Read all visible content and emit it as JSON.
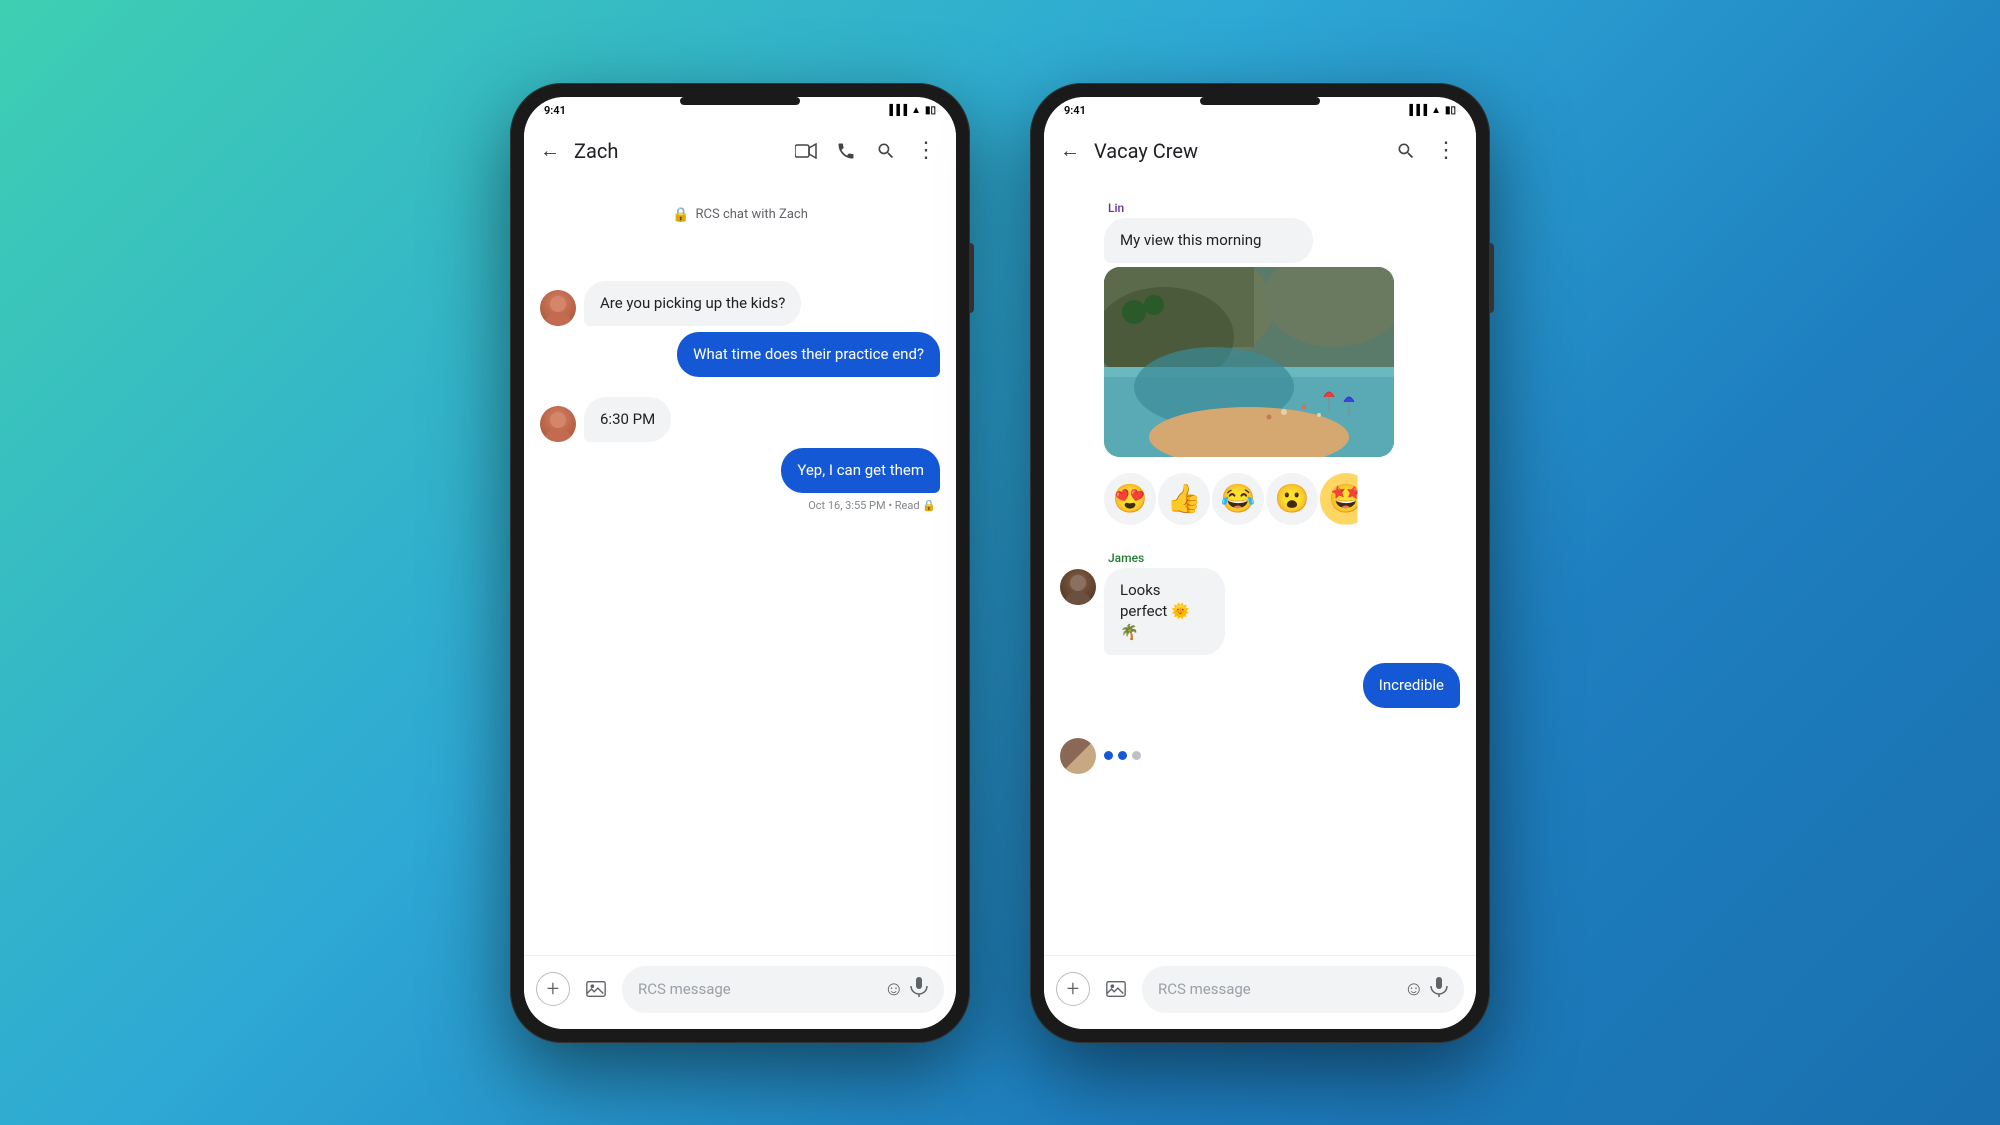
{
  "background": {
    "gradient": "teal-to-blue"
  },
  "phone1": {
    "header": {
      "back_label": "←",
      "title": "Zach",
      "icons": [
        "video",
        "phone",
        "search",
        "more"
      ]
    },
    "rcs_info": "RCS chat with Zach",
    "messages": [
      {
        "id": "msg1",
        "type": "incoming",
        "avatar": "zach",
        "text": "Are you picking up the kids?"
      },
      {
        "id": "msg2",
        "type": "outgoing",
        "text": "What time does their practice end?"
      },
      {
        "id": "msg3",
        "type": "incoming",
        "avatar": "zach",
        "text": "6:30 PM",
        "is_time": true
      },
      {
        "id": "msg4",
        "type": "outgoing",
        "text": "Yep, I can get them",
        "timestamp": "Oct 16, 3:55 PM • Read 🔒"
      }
    ],
    "input_placeholder": "RCS message"
  },
  "phone2": {
    "header": {
      "back_label": "←",
      "title": "Vacay Crew",
      "icons": [
        "search",
        "more"
      ]
    },
    "messages": [
      {
        "id": "g1",
        "type": "incoming_group",
        "sender_name": "Lin",
        "sender_color": "purple",
        "avatar": "lin",
        "text": "My view this morning",
        "has_image": true
      },
      {
        "id": "g2",
        "type": "reactions",
        "emojis": [
          "😍",
          "👍",
          "😂",
          "😮",
          "🟡"
        ]
      },
      {
        "id": "g3",
        "type": "incoming_group",
        "sender_name": "James",
        "sender_color": "green",
        "avatar": "james",
        "text": "Looks perfect 🌞 🌴"
      },
      {
        "id": "g4",
        "type": "outgoing",
        "text": "Incredible"
      },
      {
        "id": "g5",
        "type": "typing",
        "avatar": "group"
      }
    ],
    "input_placeholder": "RCS message"
  },
  "icons": {
    "back": "←",
    "video": "▭",
    "phone": "📞",
    "search": "🔍",
    "more": "⋮",
    "plus": "+",
    "media": "⊞",
    "emoji": "☺",
    "mic": "🎙",
    "lock": "🔒"
  }
}
